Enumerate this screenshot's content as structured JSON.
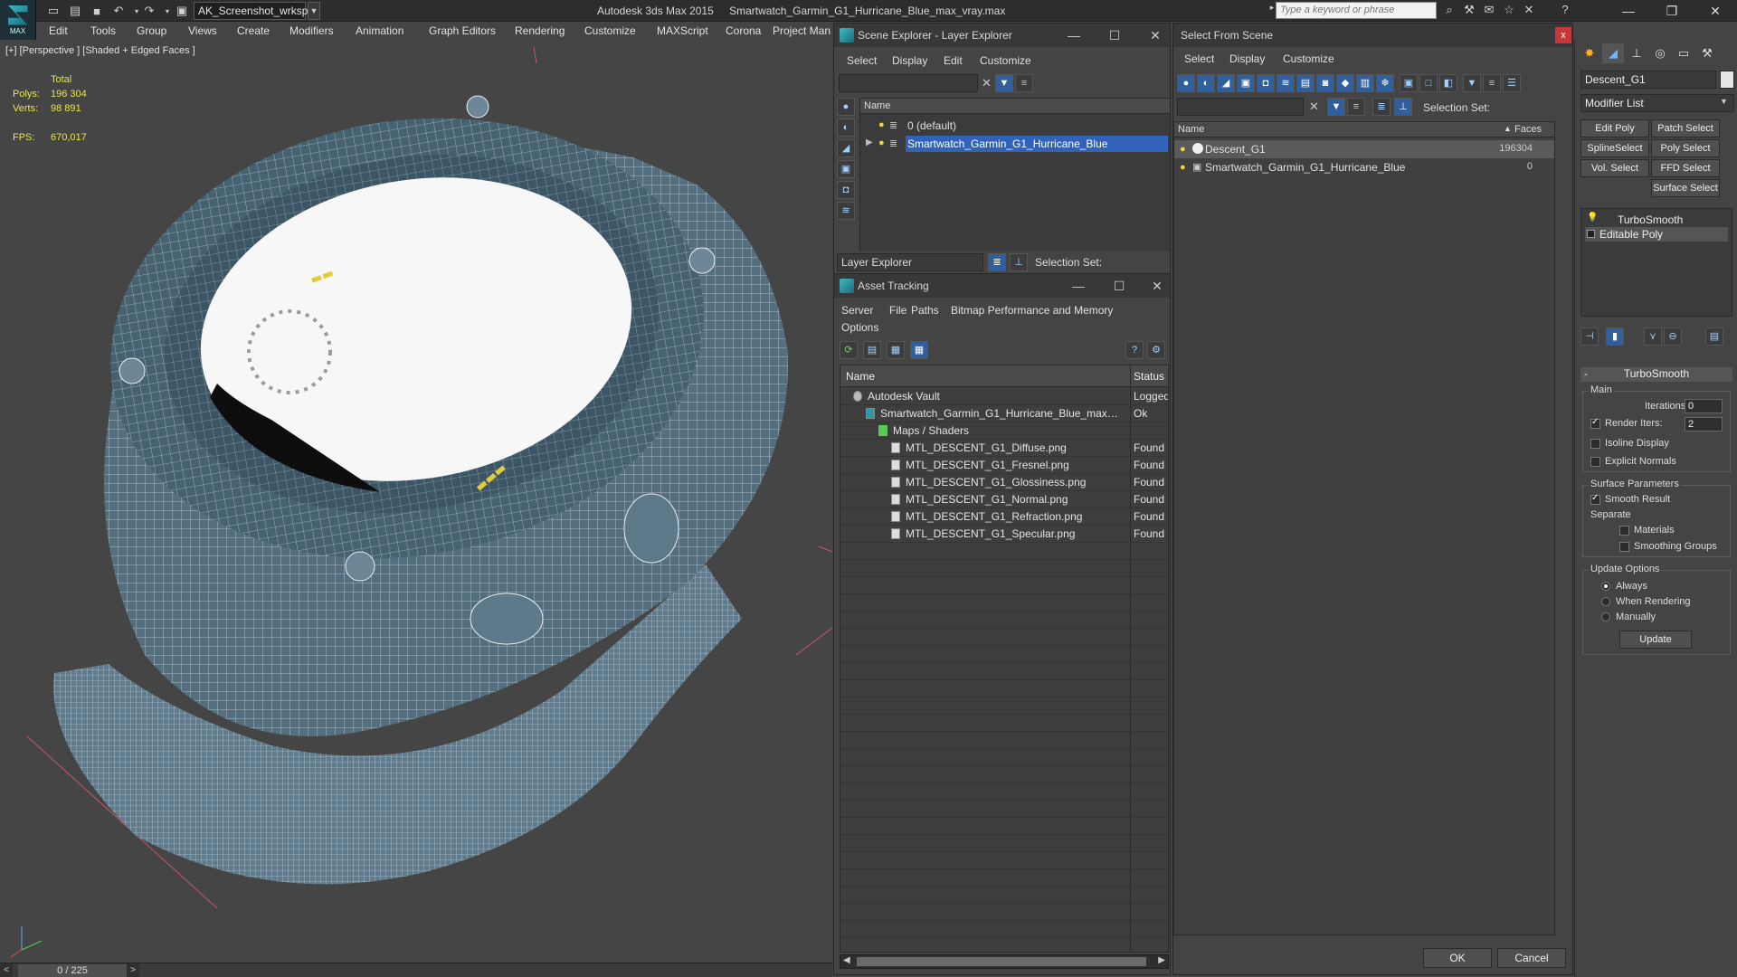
{
  "app": {
    "logo_text": "MAX",
    "workspace": "AK_Screenshot_wrksp",
    "title_app": "Autodesk 3ds Max  2015",
    "title_file": "Smartwatch_Garmin_G1_Hurricane_Blue_max_vray.max",
    "search_placeholder": "Type a keyword or phrase"
  },
  "menu": [
    "Edit",
    "Tools",
    "Group",
    "Views",
    "Create",
    "Modifiers",
    "Animation",
    "Graph Editors",
    "Rendering",
    "Customize",
    "MAXScript",
    "Corona",
    "Project Man"
  ],
  "viewport": {
    "label": "[+] [Perspective ] [Shaded + Edged Faces ]",
    "stats": {
      "total_label": "Total",
      "polys_label": "Polys:",
      "polys_value": "196 304",
      "verts_label": "Verts:",
      "verts_value": "98 891",
      "fps_label": "FPS:",
      "fps_value": "670,017"
    }
  },
  "timeline": {
    "value": "0 / 225",
    "prev": "<",
    "next": ">"
  },
  "scene_explorer": {
    "title": "Scene Explorer - Layer Explorer",
    "menu": [
      "Select",
      "Display",
      "Edit",
      "Customize"
    ],
    "column": "Name",
    "rows": [
      "0 (default)",
      "Smartwatch_Garmin_G1_Hurricane_Blue"
    ],
    "dropdown": "Layer Explorer",
    "selection_set": "Selection Set:"
  },
  "asset_tracking": {
    "title": "Asset Tracking",
    "menu": [
      "Server",
      "File",
      "Paths",
      "Bitmap Performance and Memory",
      "Options"
    ],
    "columns": {
      "name": "Name",
      "status": "Status"
    },
    "rows": [
      {
        "name": "Autodesk Vault",
        "status": "Logged",
        "indent": 0
      },
      {
        "name": "Smartwatch_Garmin_G1_Hurricane_Blue_max_v...",
        "status": "Ok",
        "indent": 1
      },
      {
        "name": "Maps / Shaders",
        "status": "",
        "indent": 2
      },
      {
        "name": "MTL_DESCENT_G1_Diffuse.png",
        "status": "Found",
        "indent": 3
      },
      {
        "name": "MTL_DESCENT_G1_Fresnel.png",
        "status": "Found",
        "indent": 3
      },
      {
        "name": "MTL_DESCENT_G1_Glossiness.png",
        "status": "Found",
        "indent": 3
      },
      {
        "name": "MTL_DESCENT_G1_Normal.png",
        "status": "Found",
        "indent": 3
      },
      {
        "name": "MTL_DESCENT_G1_Refraction.png",
        "status": "Found",
        "indent": 3
      },
      {
        "name": "MTL_DESCENT_G1_Specular.png",
        "status": "Found",
        "indent": 3
      }
    ]
  },
  "select_from_scene": {
    "title": "Select From Scene",
    "menu": [
      "Select",
      "Display",
      "Customize"
    ],
    "selection_set": "Selection Set:",
    "columns": {
      "name": "Name",
      "faces": "Faces"
    },
    "rows": [
      {
        "name": "Descent_G1",
        "faces": "196304"
      },
      {
        "name": "Smartwatch_Garmin_G1_Hurricane_Blue",
        "faces": "0"
      }
    ],
    "ok": "OK",
    "cancel": "Cancel",
    "close": "x"
  },
  "command_panel": {
    "object_name": "Descent_G1",
    "modifier_list": "Modifier List",
    "mod_buttons": [
      "Edit Poly",
      "Patch Select",
      "SplineSelect",
      "Poly Select",
      "Vol. Select",
      "FFD Select",
      "Surface Select"
    ],
    "stack": [
      "TurboSmooth",
      "Editable Poly"
    ],
    "rollout_title": "TurboSmooth",
    "main_label": "Main",
    "iterations_label": "Iterations:",
    "iterations_value": "0",
    "render_iters_label": "Render Iters:",
    "render_iters_value": "2",
    "isoline_label": "Isoline Display",
    "explicit_normals_label": "Explicit Normals",
    "surface_params_label": "Surface Parameters",
    "smooth_result_label": "Smooth Result",
    "separate_label": "Separate",
    "materials_label": "Materials",
    "smoothing_groups_label": "Smoothing Groups",
    "update_options_label": "Update Options",
    "always_label": "Always",
    "when_rendering_label": "When Rendering",
    "manually_label": "Manually",
    "update_button": "Update"
  },
  "colors": {
    "selection": "#2f62b8",
    "stat_yellow": "#e8e54e",
    "close_red": "#c8353a"
  }
}
